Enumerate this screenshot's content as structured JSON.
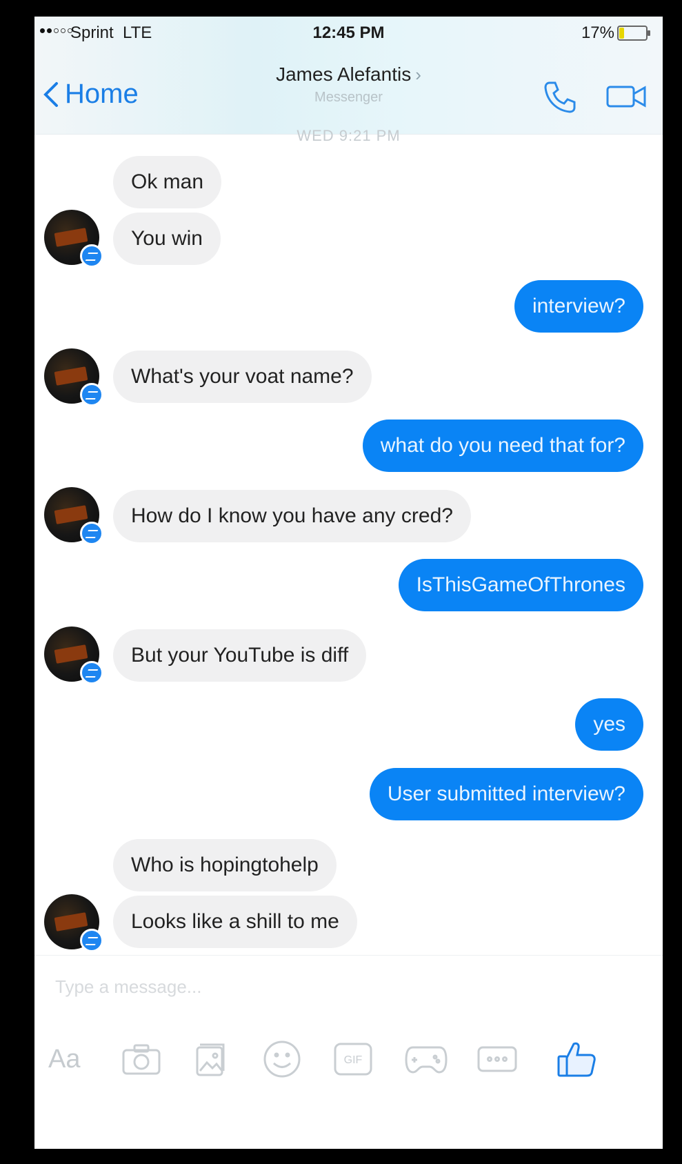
{
  "status_bar": {
    "carrier": "Sprint",
    "network": "LTE",
    "time": "12:45 PM",
    "battery": "17%",
    "battery_level": 0.17
  },
  "header": {
    "back_label": "Home",
    "contact_name": "James Alefantis",
    "subtitle": "Messenger",
    "icons": [
      "phone-icon",
      "video-camera-icon"
    ]
  },
  "timestamp": "WED 9:21 PM",
  "messages": [
    {
      "from": "them",
      "text": "Ok man"
    },
    {
      "from": "them",
      "text": "You win"
    },
    {
      "from": "me",
      "text": "interview?"
    },
    {
      "from": "them",
      "text": "What's your voat name?"
    },
    {
      "from": "me",
      "text": "what do you need that for?"
    },
    {
      "from": "them",
      "text": "How do I know you have any cred?"
    },
    {
      "from": "me",
      "text": "IsThisGameOfThrones"
    },
    {
      "from": "them",
      "text": "But your YouTube is diff"
    },
    {
      "from": "me",
      "text": "yes"
    },
    {
      "from": "me",
      "text": "User submitted interview?"
    },
    {
      "from": "them",
      "text": "Who is hopingtohelp"
    },
    {
      "from": "them",
      "text": "Looks like a shill to me"
    }
  ],
  "composer": {
    "placeholder": "Type a message...",
    "aa_label": "Aa",
    "gif_label": "GIF",
    "tools": [
      "aa-icon",
      "camera-icon",
      "gallery-icon",
      "emoji-icon",
      "gif-icon",
      "game-controller-icon",
      "more-icon",
      "thumbs-up-icon"
    ]
  },
  "colors": {
    "outgoing_bubble": "#0a84f5",
    "incoming_bubble": "#f0f0f1",
    "accent": "#1a7ee6"
  }
}
